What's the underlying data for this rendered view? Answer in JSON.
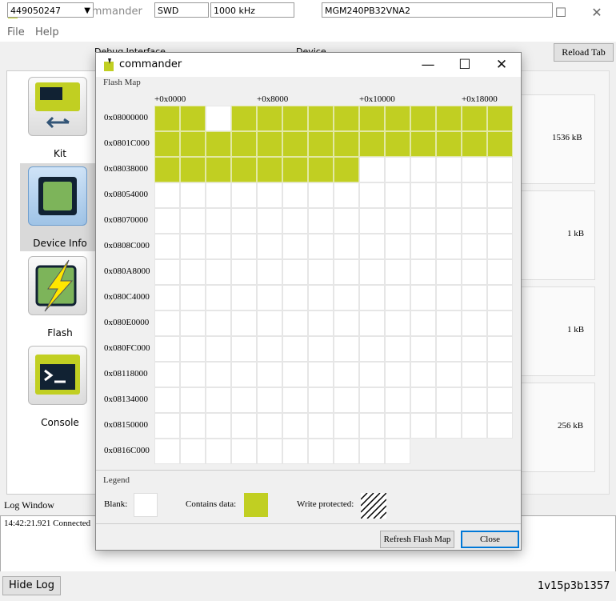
{
  "app": {
    "title": "Simplicity Commander",
    "menu": [
      "File",
      "Help"
    ],
    "toolbar": {
      "adapter": "449050247",
      "debug_interface_label": "Debug Interface",
      "debug_interface": "SWD",
      "speed": "1000 kHz",
      "device_label": "Device",
      "device": "MGM240PB32VNA2",
      "reload_tab": "Reload Tab"
    },
    "nav": [
      {
        "label": "Kit",
        "icon": "kit-usb-icon"
      },
      {
        "label": "Device Info",
        "icon": "chip-icon"
      },
      {
        "label": "Flash",
        "icon": "flash-icon"
      },
      {
        "label": "Console",
        "icon": "console-icon"
      }
    ],
    "right_values": [
      "1536 kB",
      "1 kB",
      "1 kB",
      "256 kB"
    ],
    "log": {
      "label": "Log Window",
      "text": "14:42:21.921 Connected"
    },
    "status": {
      "hide_log": "Hide Log",
      "version": "1v15p3b1357"
    }
  },
  "dialog": {
    "title": "commander",
    "flash_map_label": "Flash Map",
    "column_labels": [
      "+0x0000",
      "+0x8000",
      "+0x10000",
      "+0x18000"
    ],
    "row_labels": [
      "0x08000000",
      "0x0801C000",
      "0x08038000",
      "0x08054000",
      "0x08070000",
      "0x0808C000",
      "0x080A8000",
      "0x080C4000",
      "0x080E0000",
      "0x080FC000",
      "0x08118000",
      "0x08134000",
      "0x08150000",
      "0x0816C000"
    ],
    "rows": [
      [
        1,
        1,
        0,
        1,
        1,
        1,
        1,
        1,
        1,
        1,
        1,
        1,
        1,
        1
      ],
      [
        1,
        1,
        1,
        1,
        1,
        1,
        1,
        1,
        1,
        1,
        1,
        1,
        1,
        1
      ],
      [
        1,
        1,
        1,
        1,
        1,
        1,
        1,
        1,
        0,
        0,
        0,
        0,
        0,
        0
      ],
      [
        0,
        0,
        0,
        0,
        0,
        0,
        0,
        0,
        0,
        0,
        0,
        0,
        0,
        0
      ],
      [
        0,
        0,
        0,
        0,
        0,
        0,
        0,
        0,
        0,
        0,
        0,
        0,
        0,
        0
      ],
      [
        0,
        0,
        0,
        0,
        0,
        0,
        0,
        0,
        0,
        0,
        0,
        0,
        0,
        0
      ],
      [
        0,
        0,
        0,
        0,
        0,
        0,
        0,
        0,
        0,
        0,
        0,
        0,
        0,
        0
      ],
      [
        0,
        0,
        0,
        0,
        0,
        0,
        0,
        0,
        0,
        0,
        0,
        0,
        0,
        0
      ],
      [
        0,
        0,
        0,
        0,
        0,
        0,
        0,
        0,
        0,
        0,
        0,
        0,
        0,
        0
      ],
      [
        0,
        0,
        0,
        0,
        0,
        0,
        0,
        0,
        0,
        0,
        0,
        0,
        0,
        0
      ],
      [
        0,
        0,
        0,
        0,
        0,
        0,
        0,
        0,
        0,
        0,
        0,
        0,
        0,
        0
      ],
      [
        0,
        0,
        0,
        0,
        0,
        0,
        0,
        0,
        0,
        0,
        0,
        0,
        0,
        0
      ],
      [
        0,
        0,
        0,
        0,
        0,
        0,
        0,
        0,
        0,
        0,
        0,
        0,
        0,
        0
      ],
      [
        0,
        0,
        0,
        0,
        0,
        0,
        0,
        0,
        0,
        0
      ]
    ],
    "legend": {
      "title": "Legend",
      "blank": "Blank:",
      "contains_data": "Contains data:",
      "write_protected": "Write protected:"
    },
    "buttons": {
      "refresh": "Refresh Flash Map",
      "close": "Close"
    },
    "colors": {
      "data": "#c1cf22",
      "blank": "#ffffff"
    }
  }
}
